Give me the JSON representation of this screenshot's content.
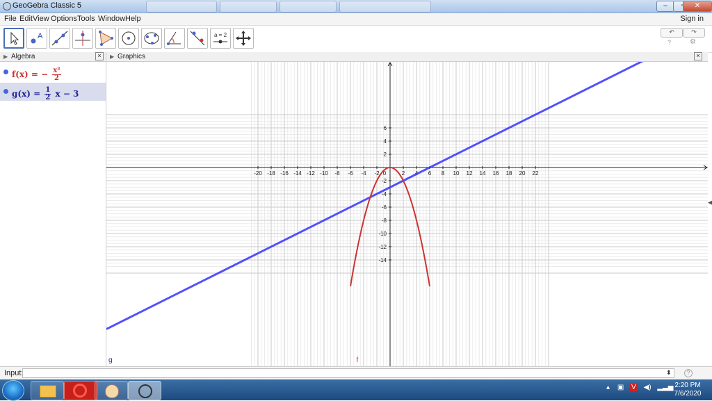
{
  "window": {
    "title": "GeoGebra Classic 5"
  },
  "menu": {
    "items": [
      "File",
      "Edit",
      "View",
      "Options",
      "Tools",
      "Window",
      "Help"
    ],
    "sign_in": "Sign in"
  },
  "toolbar": {
    "tools": [
      "move-tool-icon",
      "point-tool-icon",
      "line-tool-icon",
      "perpendicular-tool-icon",
      "polygon-tool-icon",
      "circle-tool-icon",
      "conic-tool-icon",
      "angle-tool-icon",
      "reflect-tool-icon",
      "slider-tool-icon",
      "move-graphics-tool-icon"
    ],
    "slider_label": "a = 2"
  },
  "algebra": {
    "title": "Algebra",
    "items": [
      {
        "name": "f",
        "lhs": "f(x) = −",
        "num": "x²",
        "den": "2",
        "rest": "",
        "color": "#cc3333"
      },
      {
        "name": "g",
        "lhs": "g(x) =",
        "num": "1",
        "den": "2",
        "rest": "x − 3",
        "color": "#1a1aa6"
      }
    ]
  },
  "graphics": {
    "title": "Graphics",
    "x_ticks": [
      "-20",
      "-18",
      "-16",
      "-14",
      "-12",
      "-10",
      "-8",
      "-6",
      "-4",
      "-2",
      "0",
      "2",
      "4",
      "6",
      "8",
      "10",
      "12",
      "14",
      "16",
      "18",
      "20",
      "22"
    ],
    "y_ticks": [
      "6",
      "4",
      "2",
      "-2",
      "-4",
      "-6",
      "-8",
      "-10",
      "-12",
      "-14"
    ],
    "label_g": "g",
    "label_f": "f",
    "colors": {
      "f": "#cc3333",
      "g": "#3333ff",
      "grid_major": "#c8c8c8",
      "grid_minor": "#ebebeb"
    }
  },
  "chart_data": {
    "type": "line",
    "x_range": [
      -21,
      24
    ],
    "y_range": [
      -15,
      8
    ],
    "grid": true,
    "functions": [
      {
        "name": "f",
        "expression": "-x^2/2"
      },
      {
        "name": "g",
        "expression": "x/2 - 3"
      }
    ]
  },
  "input": {
    "label": "Input:",
    "value": ""
  },
  "taskbar": {
    "clock_time": "2:20 PM",
    "clock_date": "7/6/2020"
  }
}
